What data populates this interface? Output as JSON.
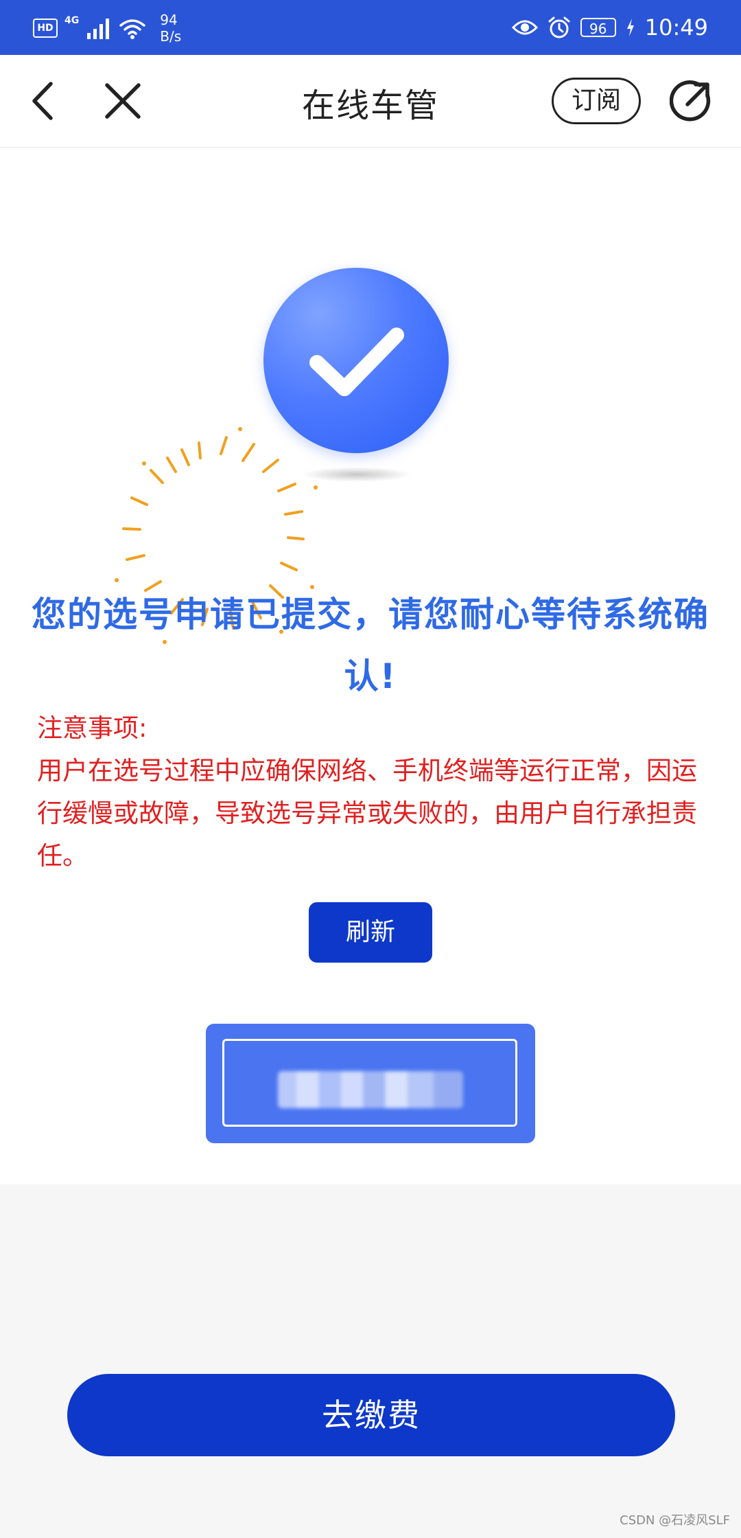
{
  "status_bar": {
    "hd_label": "HD",
    "network_label": "4G",
    "speed_value": "94",
    "speed_unit": "B/s",
    "battery_level": "96",
    "time": "10:49",
    "colors": {
      "background": "#2a55d6",
      "text": "#ffffff"
    }
  },
  "nav": {
    "title": "在线车管",
    "subscribe_label": "订阅",
    "icons": [
      "back-arrow-icon",
      "close-icon",
      "share-icon"
    ]
  },
  "content": {
    "headline": "您的选号申请已提交，请您耐心等待系统确认!",
    "notice_title": "注意事项:",
    "notice_body": "用户在选号过程中应确保网络、手机终端等运行正常，因运行缓慢或故障，导致选号异常或失败的，由用户自行承担责任。",
    "refresh_label": "刷新",
    "colors": {
      "headline": "#2f6ae6",
      "notice": "#e02020",
      "button": "#0d38c9",
      "success_circle": "#4f7bff"
    }
  },
  "footer": {
    "pay_label": "去缴费",
    "watermark": "CSDN @石凌风SLF"
  }
}
